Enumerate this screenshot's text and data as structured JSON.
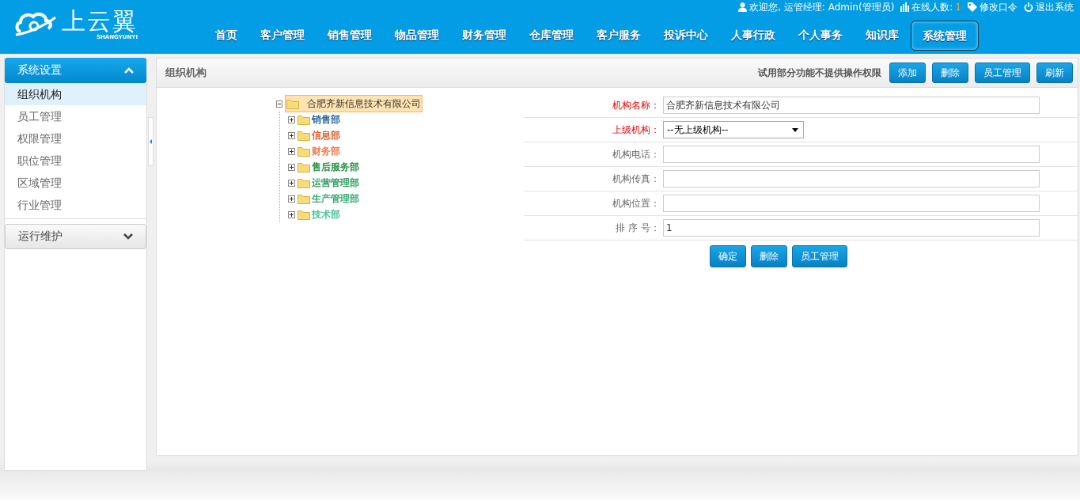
{
  "header": {
    "logo": {
      "name": "上云翼",
      "subtitle": "SHANGYUNYI"
    },
    "user_bar": [
      {
        "kind": "user",
        "text": "欢迎您, 运管经理: Admin(管理员)"
      },
      {
        "kind": "stats",
        "text": "在线人数:",
        "count": "1"
      },
      {
        "kind": "tag",
        "text": "修改口令"
      },
      {
        "kind": "power",
        "text": "退出系统"
      }
    ],
    "nav": [
      {
        "label": "首页",
        "selected": false
      },
      {
        "label": "客户管理",
        "selected": false
      },
      {
        "label": "销售管理",
        "selected": false
      },
      {
        "label": "物品管理",
        "selected": false
      },
      {
        "label": "财务管理",
        "selected": false
      },
      {
        "label": "仓库管理",
        "selected": false
      },
      {
        "label": "客户服务",
        "selected": false
      },
      {
        "label": "投诉中心",
        "selected": false
      },
      {
        "label": "人事行政",
        "selected": false
      },
      {
        "label": "个人事务",
        "selected": false
      },
      {
        "label": "知识库",
        "selected": false
      },
      {
        "label": "系统管理",
        "selected": true
      }
    ]
  },
  "sidebar": {
    "groups": [
      {
        "title": "系统设置",
        "expanded": true,
        "items": [
          {
            "label": "组织机构",
            "selected": true
          },
          {
            "label": "员工管理",
            "selected": false
          },
          {
            "label": "权限管理",
            "selected": false
          },
          {
            "label": "职位管理",
            "selected": false
          },
          {
            "label": "区域管理",
            "selected": false
          },
          {
            "label": "行业管理",
            "selected": false
          }
        ]
      },
      {
        "title": "运行维护",
        "expanded": false
      }
    ]
  },
  "panel": {
    "title": "组织机构",
    "notice": "试用部分功能不提供操作权限",
    "buttons": [
      "添加",
      "删除",
      "员工管理",
      "刷新"
    ],
    "tree": {
      "label": "合肥齐新信息技术有限公司",
      "selected": true,
      "expanded": true,
      "children": [
        {
          "label": "销售部",
          "color": "#1f5fa0",
          "expanded": false
        },
        {
          "label": "信息部",
          "color": "#e0561e",
          "expanded": false
        },
        {
          "label": "财务部",
          "color": "#f07040",
          "expanded": false
        },
        {
          "label": "售后服务部",
          "color": "#1a8a3a",
          "expanded": false
        },
        {
          "label": "运营管理部",
          "color": "#2a9a5a",
          "expanded": false
        },
        {
          "label": "生产管理部",
          "color": "#30a870",
          "expanded": false
        },
        {
          "label": "技术部",
          "color": "#40c090",
          "expanded": false
        }
      ]
    },
    "form": {
      "fields": [
        {
          "label": "机构名称：",
          "required": true,
          "kind": "text",
          "value": "合肥齐新信息技术有限公司"
        },
        {
          "label": "上级机构：",
          "required": true,
          "kind": "select",
          "value": "--无上级机构--"
        },
        {
          "label": "机构电话：",
          "required": false,
          "kind": "text"
        },
        {
          "label": "机构传真：",
          "required": false,
          "kind": "text"
        },
        {
          "label": "机构位置：",
          "required": false,
          "kind": "text"
        },
        {
          "label": "排 序 号：",
          "required": false,
          "kind": "text",
          "value": "1"
        }
      ],
      "buttons": [
        "确定",
        "删除",
        "员工管理"
      ]
    }
  }
}
